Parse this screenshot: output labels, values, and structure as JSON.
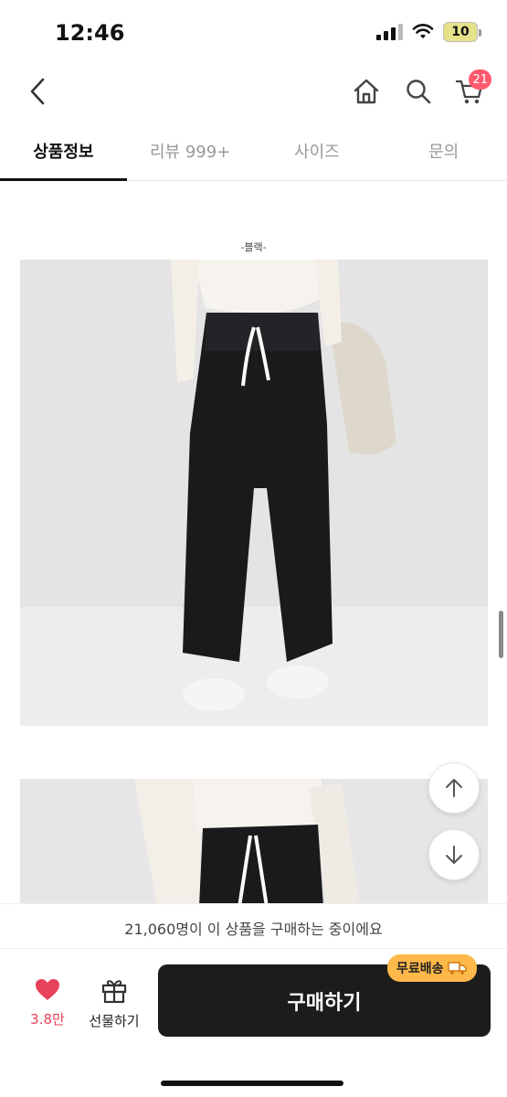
{
  "status_bar": {
    "time": "12:46",
    "battery": "10"
  },
  "header": {
    "cart_count": "21"
  },
  "tabs": [
    {
      "label": "상품정보",
      "active": true
    },
    {
      "label": "리뷰 999+",
      "active": false
    },
    {
      "label": "사이즈",
      "active": false
    },
    {
      "label": "문의",
      "active": false
    }
  ],
  "content": {
    "color_caption": "-블랙-"
  },
  "buyers_notice": "21,060명이 이 상품을 구매하는 중이에요",
  "bottom_bar": {
    "like_count": "3.8만",
    "gift_label": "선물하기",
    "buy_label": "구매하기",
    "free_shipping_label": "무료배송"
  },
  "colors": {
    "accent_red": "#ff5a6e",
    "buy_button": "#1c1c1c",
    "free_shipping": "#ffb84a"
  }
}
